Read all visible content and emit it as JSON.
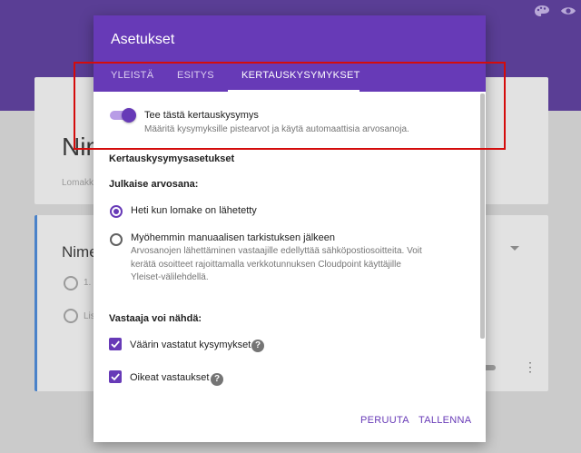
{
  "background": {
    "form_title_partial": "Nim",
    "form_desc_partial": "Lomakk",
    "question_title_partial": "Nime",
    "option_1_partial": "1.",
    "option_2_partial": "Lis"
  },
  "dialog": {
    "title": "Asetukset",
    "tabs": [
      {
        "label": "YLEISTÄ"
      },
      {
        "label": "ESITYS"
      },
      {
        "label": "KERTAUSKYSYMYKSET"
      }
    ],
    "quiz_toggle": {
      "label": "Tee tästä kertauskysymys",
      "description": "Määritä kysymyksille pistearvot ja käytä automaattisia arvosanoja.",
      "enabled": true
    },
    "section_title": "Kertauskysymysasetukset",
    "release_grade": {
      "heading": "Julkaise arvosana:",
      "options": [
        {
          "label": "Heti kun lomake on lähetetty",
          "selected": true
        },
        {
          "label": "Myöhemmin manuaalisen tarkistuksen jälkeen",
          "description_1": "Arvosanojen lähettäminen vastaajille edellyttää sähköpostiosoitteita. Voit",
          "description_2": "kerätä osoitteet rajoittamalla verkkotunnuksen Cloudpoint käyttäjille",
          "description_3": "Yleiset-välilehdellä.",
          "selected": false
        }
      ]
    },
    "respondent_can_see": {
      "heading": "Vastaaja voi nähdä:",
      "items": [
        {
          "label": "Väärin vastatut kysymykset",
          "checked": true
        },
        {
          "label": "Oikeat vastaukset",
          "checked": true
        }
      ]
    },
    "buttons": {
      "cancel": "PERUUTA",
      "save": "TALLENNA"
    }
  },
  "colors": {
    "accent": "#673ab7",
    "highlight_box": "#d40c0c"
  },
  "icons": {
    "palette": "palette-icon",
    "preview": "eye-icon",
    "help": "help-icon"
  }
}
